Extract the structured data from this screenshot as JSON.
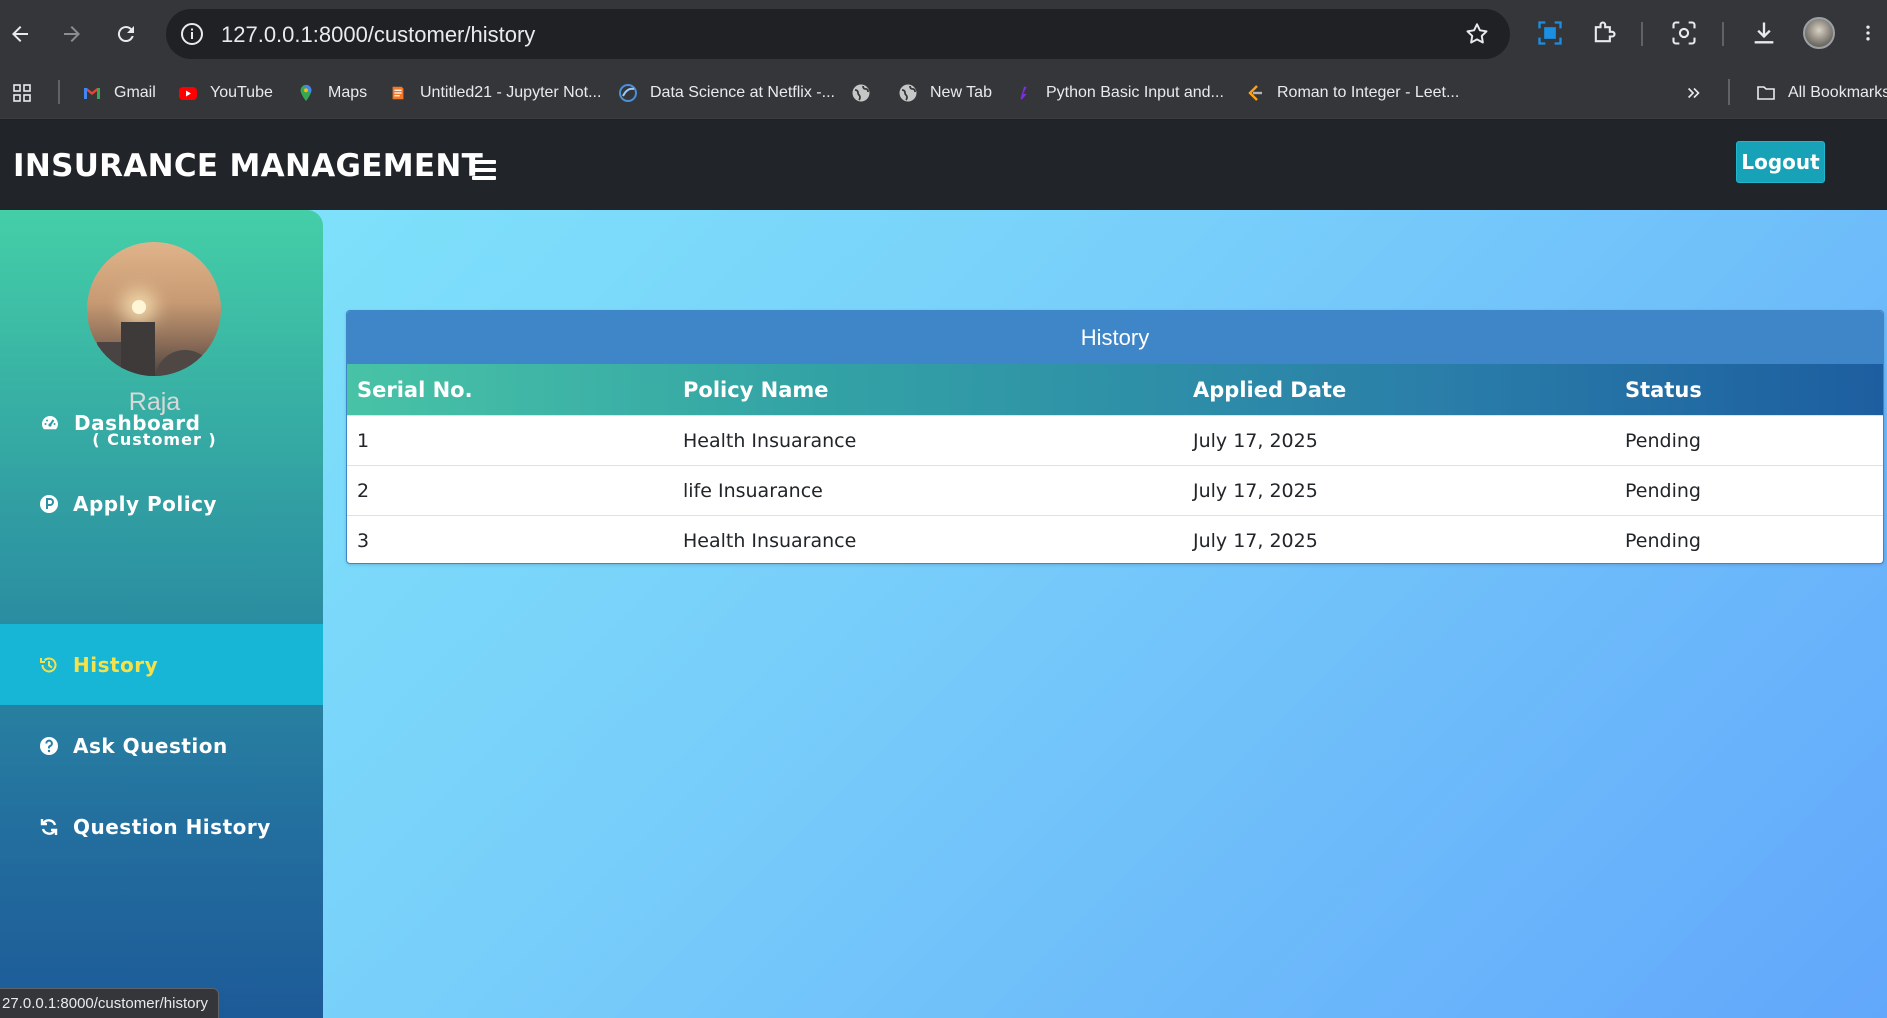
{
  "browser": {
    "url": "127.0.0.1:8000/customer/history",
    "bookmarks": [
      {
        "label": "Gmail",
        "icon": "gmail-icon"
      },
      {
        "label": "YouTube",
        "icon": "youtube-icon"
      },
      {
        "label": "Maps",
        "icon": "maps-icon"
      },
      {
        "label": "Untitled21 - Jupyter Not...",
        "icon": "jupyter-icon"
      },
      {
        "label": "Data Science at Netflix -...",
        "icon": "website-icon"
      },
      {
        "label": "",
        "icon": "globe-icon"
      },
      {
        "label": "New Tab",
        "icon": "globe-icon"
      },
      {
        "label": "Python Basic Input and...",
        "icon": "website-icon"
      },
      {
        "label": "Roman to Integer - Leet...",
        "icon": "leetcode-icon"
      }
    ],
    "all_bookmarks": "All Bookmarks",
    "status_url": "27.0.0.1:8000/customer/history"
  },
  "header": {
    "brand": "INSURANCE MANAGEMENT",
    "logout_label": "Logout"
  },
  "sidebar": {
    "user_name": "Raja",
    "user_role": "( Customer )",
    "items": [
      {
        "label": "Dashboard",
        "icon": "dashboard-icon",
        "active": false
      },
      {
        "label": "Apply Policy",
        "icon": "policy-icon",
        "active": false
      },
      {
        "label": "History",
        "icon": "history-icon",
        "active": true
      },
      {
        "label": "Ask Question",
        "icon": "question-icon",
        "active": false
      },
      {
        "label": "Question History",
        "icon": "refresh-icon",
        "active": false
      }
    ]
  },
  "history": {
    "title": "History",
    "columns": [
      "Serial No.",
      "Policy Name",
      "Applied Date",
      "Status"
    ],
    "rows": [
      [
        "1",
        "Health Insuarance",
        "July 17, 2025",
        "Pending"
      ],
      [
        "2",
        "life Insuarance",
        "July 17, 2025",
        "Pending"
      ],
      [
        "3",
        "Health Insuarance",
        "July 17, 2025",
        "Pending"
      ]
    ]
  },
  "colors": {
    "header_bg": "#212529",
    "logout_bg": "#17a2b8",
    "active_item_bg": "#17b6d6",
    "active_item_text": "#f5e24b",
    "card_header_bg": "#3e86c7"
  }
}
